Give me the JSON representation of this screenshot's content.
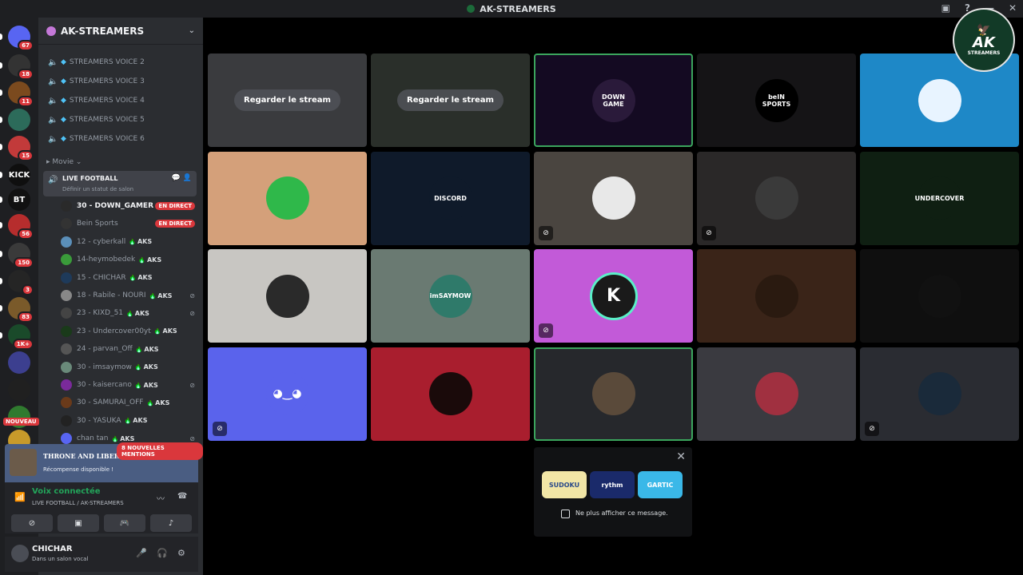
{
  "window": {
    "title": "AK-STREAMERS",
    "controls": [
      "▣",
      "?",
      "—",
      "✕"
    ]
  },
  "servers": [
    {
      "label": "",
      "badge": "67",
      "color": "#5865f2",
      "icon": "discord-home-icon"
    },
    {
      "label": "",
      "badge": "18",
      "color": "#333",
      "icon": "server-icon"
    },
    {
      "label": "",
      "badge": "11",
      "color": "#7b4a1e",
      "icon": "server-icon"
    },
    {
      "label": "",
      "badge": "",
      "color": "#2c6b5a",
      "icon": "server-icon"
    },
    {
      "label": "",
      "badge": "15",
      "color": "#c23a3a",
      "icon": "server-icon"
    },
    {
      "label": "KICK",
      "badge": "",
      "color": "#0f0f0f",
      "icon": "kick-icon"
    },
    {
      "label": "BT",
      "badge": "",
      "color": "#111",
      "icon": "server-icon"
    },
    {
      "label": "",
      "badge": "56",
      "color": "#b62d2d",
      "icon": "server-icon"
    },
    {
      "label": "",
      "badge": "150",
      "color": "#3a3a3a",
      "icon": "server-icon"
    },
    {
      "label": "",
      "badge": "3",
      "color": "#252525",
      "icon": "server-icon"
    },
    {
      "label": "",
      "badge": "83",
      "color": "#7a5a2a",
      "icon": "server-icon"
    },
    {
      "label": "",
      "badge": "1K+",
      "color": "#1a4a2a",
      "icon": "server-icon"
    },
    {
      "label": "",
      "badge": "",
      "color": "#3c3f8f",
      "icon": "folder-icon"
    },
    {
      "label": "",
      "badge": "",
      "color": "#202020",
      "icon": "server-icon"
    },
    {
      "label": "",
      "badge": "",
      "color": "#2f7a2f",
      "icon": "server-icon"
    },
    {
      "label": "",
      "badge": "",
      "color": "#c89a2a",
      "icon": "server-icon"
    }
  ],
  "nouveau": "NOUVEAU",
  "server_name": "AK-STREAMERS",
  "channels": [
    "STREAMERS VOICE 2",
    "STREAMERS VOICE 3",
    "STREAMERS VOICE 4",
    "STREAMERS VOICE 5",
    "STREAMERS VOICE 6"
  ],
  "category": "Movie",
  "live_channel": {
    "name": "LIVE FOOTBALL",
    "status": "Définir un statut de salon"
  },
  "voice_users": [
    {
      "name": "30 - DOWN_GAMER",
      "tag": "",
      "live": "EN DIRECT",
      "color": "#2a2a2a"
    },
    {
      "name": "Bein Sports",
      "tag": "",
      "live": "EN DIRECT",
      "color": "#333"
    },
    {
      "name": "12 - cyberkall",
      "tag": "AKS",
      "live": "",
      "color": "#5b8fb9"
    },
    {
      "name": "14-heymobedek",
      "tag": "AKS",
      "live": "",
      "color": "#3a9b3a"
    },
    {
      "name": "15 - CHICHAR",
      "tag": "AKS",
      "live": "",
      "color": "#1e3a5a"
    },
    {
      "name": "18 - Rabile - NOURI",
      "tag": "AKS",
      "live": "",
      "color": "#888"
    },
    {
      "name": "23 - KIXD_51",
      "tag": "AKS",
      "live": "",
      "color": "#444"
    },
    {
      "name": "23 - Undercover00yt",
      "tag": "AKS",
      "live": "",
      "color": "#1a3a1a"
    },
    {
      "name": "24 - parvan_Off",
      "tag": "AKS",
      "live": "",
      "color": "#555"
    },
    {
      "name": "30 - imsaymow",
      "tag": "AKS",
      "live": "",
      "color": "#6a8a7a"
    },
    {
      "name": "30 - kaisercano",
      "tag": "AKS",
      "live": "",
      "color": "#7a2a9a"
    },
    {
      "name": "30 - SAMURAI_OFF",
      "tag": "AKS",
      "live": "",
      "color": "#6a3a1a"
    },
    {
      "name": "30 - YASUKA",
      "tag": "AKS",
      "live": "",
      "color": "#222"
    },
    {
      "name": "chan tan",
      "tag": "AKS",
      "live": "",
      "color": "#5865f2"
    }
  ],
  "mentions": "8 NOUVELLES MENTIONS",
  "promo": {
    "title": "THRONE AND LIBERTY",
    "text": "Récompense disponible !"
  },
  "voice": {
    "title": "Voix connectée",
    "sub": "LIVE FOOTBALL / AK-STREAMERS"
  },
  "user": {
    "name": "CHICHAR",
    "status": "Dans un salon vocal"
  },
  "tiles": [
    {
      "bg": "#3a3b3e",
      "avatar": "",
      "avcolor": "",
      "watch": "Regarder le stream",
      "mute": false,
      "sel": false
    },
    {
      "bg": "#2a2f2a",
      "avatar": "",
      "avcolor": "",
      "watch": "Regarder le stream",
      "mute": false,
      "sel": false
    },
    {
      "bg": "#140a22",
      "avatar": "DOWN GAME",
      "avcolor": "#2a1a3a",
      "watch": "",
      "mute": false,
      "sel": true
    },
    {
      "bg": "#151416",
      "avatar": "beIN SPORTS",
      "avcolor": "#000",
      "watch": "",
      "mute": false,
      "sel": false
    },
    {
      "bg": "#1e88c7",
      "avatar": "",
      "avcolor": "#e8f4ff",
      "watch": "",
      "mute": false,
      "sel": false
    },
    {
      "bg": "#d4a07a",
      "avatar": "",
      "avcolor": "#2fb84a",
      "watch": "",
      "mute": false,
      "sel": false
    },
    {
      "bg": "#0f1a2a",
      "avatar": "DISCORD",
      "avcolor": "#0f1a2a",
      "watch": "",
      "mute": false,
      "sel": false
    },
    {
      "bg": "#4a4540",
      "avatar": "",
      "avcolor": "#e8e8e8",
      "watch": "",
      "mute": true,
      "sel": false
    },
    {
      "bg": "#2a2828",
      "avatar": "",
      "avcolor": "#3a3a3a",
      "watch": "",
      "mute": true,
      "sel": false
    },
    {
      "bg": "#0f1f12",
      "avatar": "UNDERCOVER",
      "avcolor": "#0f1f12",
      "watch": "",
      "mute": false,
      "sel": false
    },
    {
      "bg": "#c8c6c2",
      "avatar": "",
      "avcolor": "#2a2a2a",
      "watch": "",
      "mute": false,
      "sel": false
    },
    {
      "bg": "#6a7a72",
      "avatar": "imSAYMOW",
      "avcolor": "#2f7a6a",
      "watch": "",
      "mute": false,
      "sel": false
    },
    {
      "bg": "#c25ad8",
      "avatar": "K",
      "avcolor": "#1a1a1a",
      "watch": "",
      "mute": true,
      "sel": false
    },
    {
      "bg": "#3a2418",
      "avatar": "",
      "avcolor": "#2a1a10",
      "watch": "",
      "mute": false,
      "sel": false
    },
    {
      "bg": "#0f0f0f",
      "avatar": "",
      "avcolor": "#111",
      "watch": "",
      "mute": false,
      "sel": false
    },
    {
      "bg": "#5a63ec",
      "avatar": "discord-logo",
      "avcolor": "#5a63ec",
      "watch": "",
      "mute": true,
      "sel": false
    },
    {
      "bg": "#a91e2e",
      "avatar": "",
      "avcolor": "#1a0a0a",
      "watch": "",
      "mute": false,
      "sel": false
    },
    {
      "bg": "#26282c",
      "avatar": "",
      "avcolor": "#5a4a3a",
      "watch": "",
      "mute": false,
      "sel": true
    },
    {
      "bg": "#3a3a40",
      "avatar": "",
      "avcolor": "#a03040",
      "watch": "",
      "mute": false,
      "sel": false
    },
    {
      "bg": "#2a2c32",
      "avatar": "",
      "avcolor": "#1a2a3a",
      "watch": "",
      "mute": true,
      "sel": false
    }
  ],
  "popup": {
    "activities": [
      "SUDOKU",
      "rythm",
      "GARTIC"
    ],
    "checkbox": "Ne plus afficher ce message."
  },
  "logo": {
    "text": "AK",
    "sub": "STREAMERS"
  }
}
